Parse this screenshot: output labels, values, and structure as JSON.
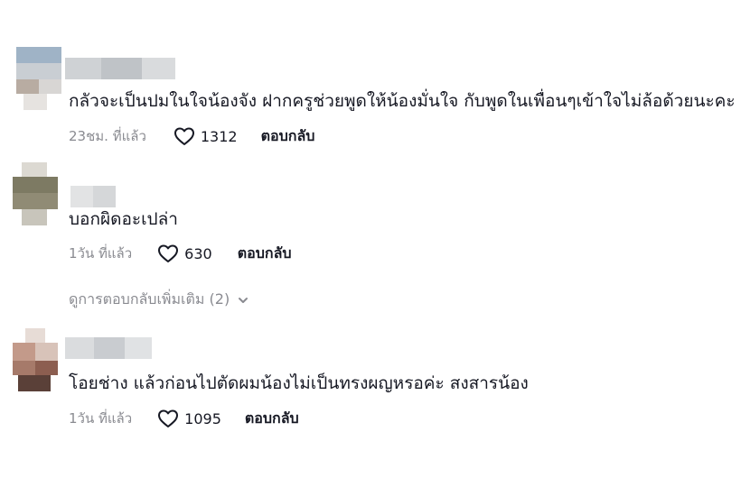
{
  "comments": [
    {
      "text": "กลัวจะเป็นปมในใจน้องจัง ฝากครูช่วยพูดให้น้องมั่นใจ กับพูดในเพื่อนๆเข้าใจไม่ล้อด้วยนะคะ",
      "time": "23ชม. ที่แล้ว",
      "likes": "1312",
      "reply_label": "ตอบกลับ"
    },
    {
      "text": "บอกผิดอะเปล่า",
      "time": "1วัน ที่แล้ว",
      "likes": "630",
      "reply_label": "ตอบกลับ"
    },
    {
      "text": "โอยช่าง แล้วก่อนไปตัดผมน้องไม่เป็นทรงผญหรอค่ะ สงสารน้อง",
      "time": "1วัน ที่แล้ว",
      "likes": "1095",
      "reply_label": "ตอบกลับ"
    }
  ],
  "view_more": {
    "label": "ดูการตอบกลับเพิ่มเติม (2)"
  },
  "icons": {
    "like": "heart-outline-icon",
    "expand": "chevron-down-icon"
  },
  "colors": {
    "text": "#161823",
    "muted": "#8a8b91",
    "background": "#ffffff"
  }
}
